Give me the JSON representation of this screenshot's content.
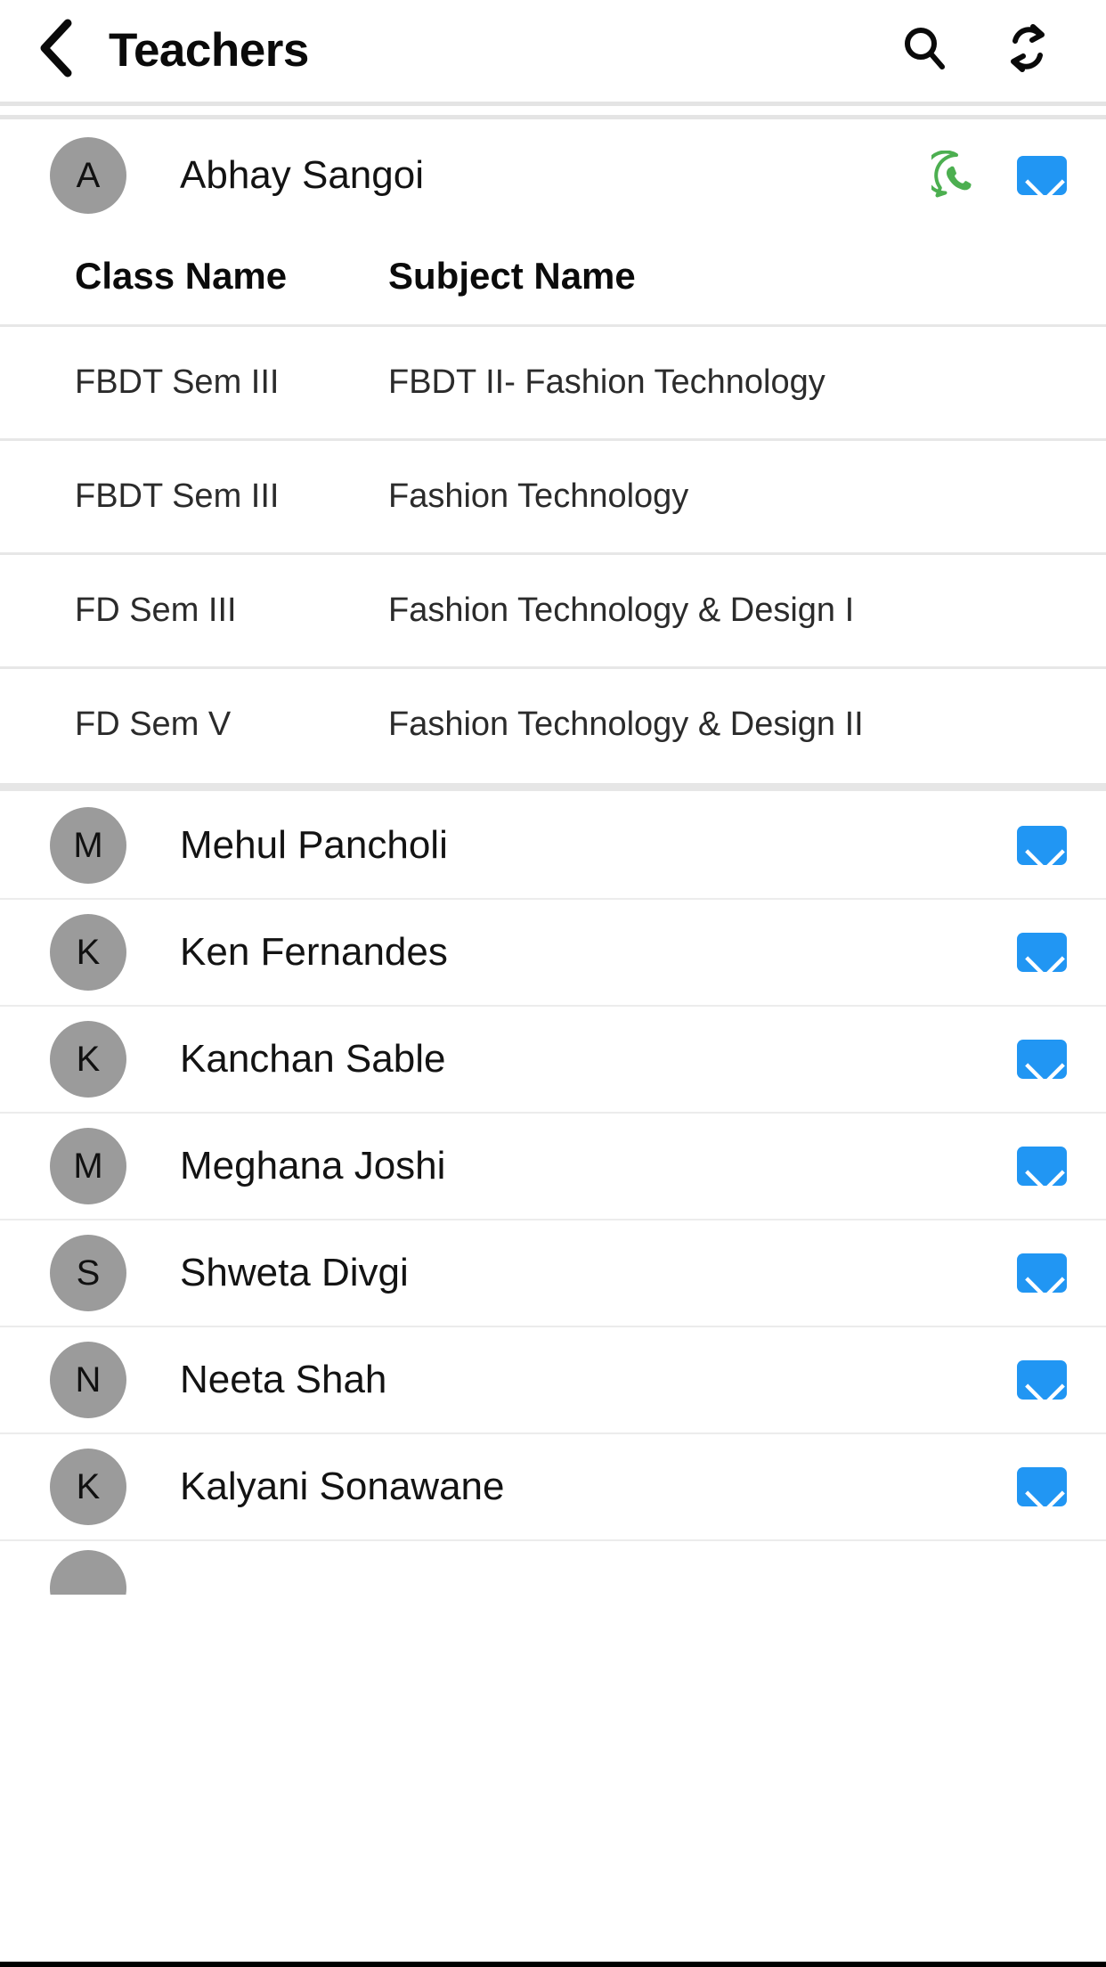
{
  "header": {
    "title": "Teachers",
    "back_icon": "chevron-left-icon",
    "search_icon": "search-icon",
    "refresh_icon": "refresh-sync-icon"
  },
  "expanded_teacher": {
    "initial": "A",
    "name": "Abhay Sangoi",
    "whatsapp_icon": "whatsapp-icon",
    "mail_icon": "mail-icon",
    "table": {
      "headers": [
        "Class Name",
        "Subject Name"
      ],
      "rows": [
        {
          "class_name": "FBDT Sem III",
          "subject_name": "FBDT II- Fashion Technology"
        },
        {
          "class_name": "FBDT Sem III",
          "subject_name": "Fashion Technology"
        },
        {
          "class_name": "FD Sem III",
          "subject_name": "Fashion Technology & Design I"
        },
        {
          "class_name": "FD Sem V",
          "subject_name": "Fashion Technology & Design II"
        }
      ]
    }
  },
  "teachers": [
    {
      "initial": "M",
      "name": "Mehul Pancholi",
      "mail_icon": "mail-icon"
    },
    {
      "initial": "K",
      "name": "Ken Fernandes",
      "mail_icon": "mail-icon"
    },
    {
      "initial": "K",
      "name": "Kanchan Sable",
      "mail_icon": "mail-icon"
    },
    {
      "initial": "M",
      "name": "Meghana Joshi",
      "mail_icon": "mail-icon"
    },
    {
      "initial": "S",
      "name": "Shweta Divgi",
      "mail_icon": "mail-icon"
    },
    {
      "initial": "N",
      "name": "Neeta Shah",
      "mail_icon": "mail-icon"
    },
    {
      "initial": "K",
      "name": "Kalyani Sonawane",
      "mail_icon": "mail-icon"
    }
  ],
  "colors": {
    "avatar_bg": "#9b9b9b",
    "mail_blue": "#2196f3",
    "whatsapp_green": "#4caf50",
    "divider": "#e6e6e6",
    "text_primary": "#131313"
  }
}
